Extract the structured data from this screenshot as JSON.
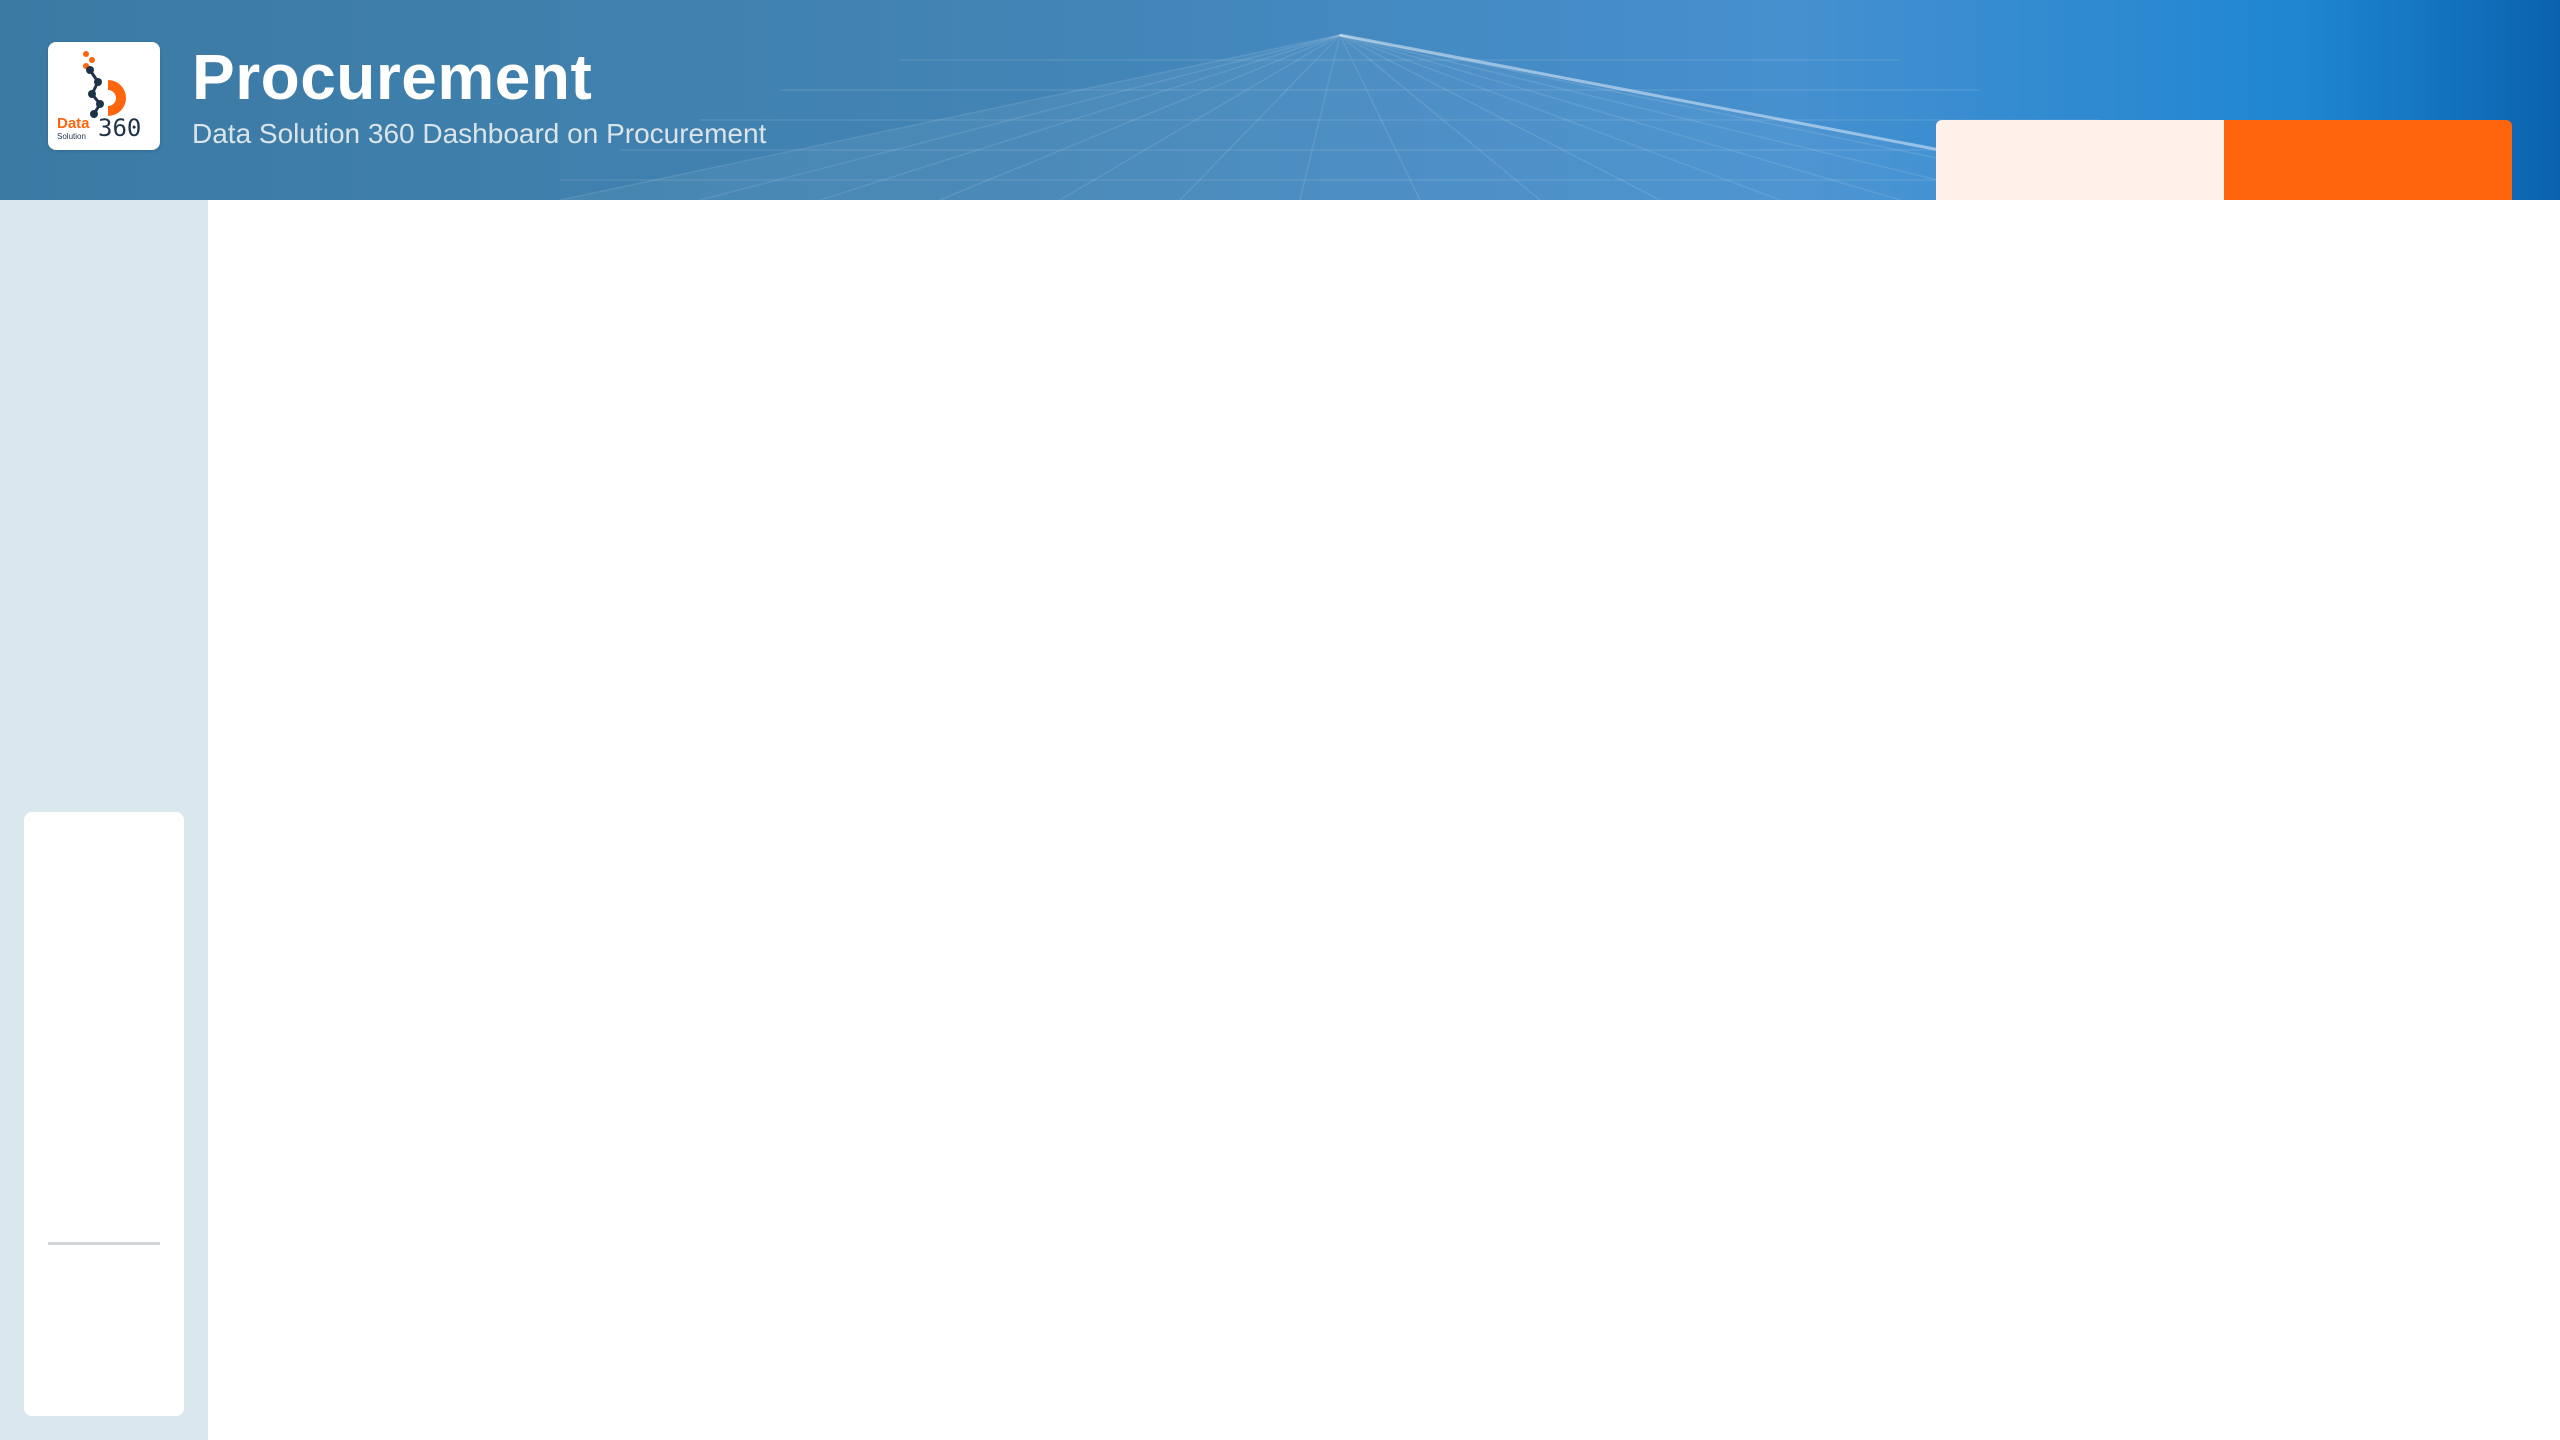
{
  "header": {
    "title": "Procurement",
    "subtitle": "Data Solution 360 Dashboard on Procurement",
    "logo": {
      "word_data": "Data",
      "word_solution": "Solution",
      "word_360": "360"
    }
  },
  "colors": {
    "header_blue": "#4284b5",
    "accent_orange": "#fe650d",
    "tab_light": "#fdf1e9",
    "sidebar_bg": "#dbe7ee",
    "logo_navy": "#1f3348"
  }
}
